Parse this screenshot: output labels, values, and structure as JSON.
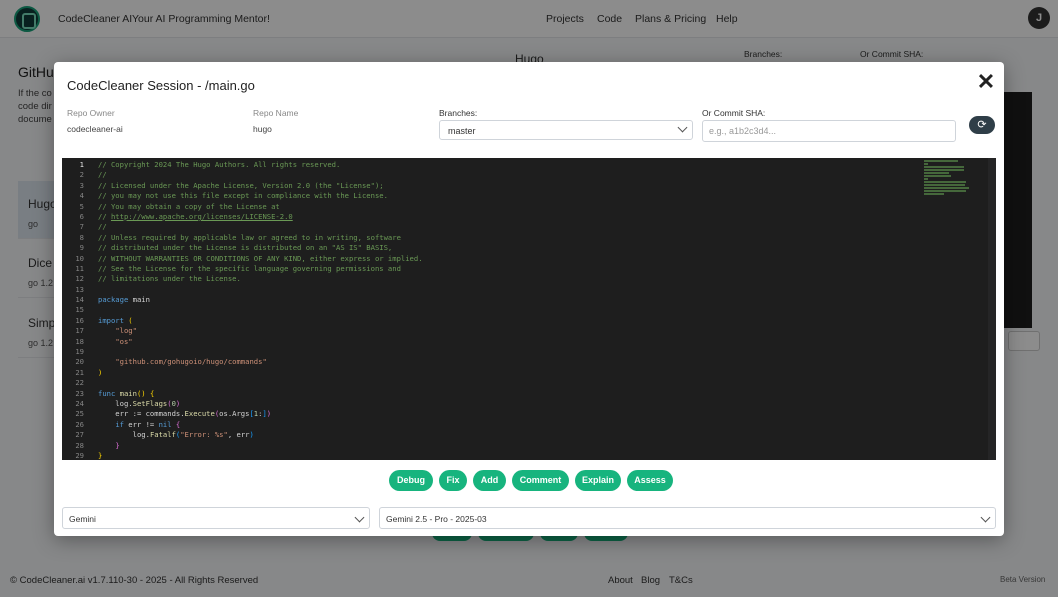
{
  "header": {
    "brand": "CodeCleaner AI",
    "tagline": "Your AI Programming Mentor!",
    "nav": [
      "Projects",
      "Code",
      "Plans & Pricing",
      "Help"
    ],
    "avatar_initial": "J"
  },
  "background": {
    "title_fragment": "GitHu",
    "text_fragments": [
      "If the co",
      "code dir",
      "docume"
    ],
    "repo_cards": [
      {
        "name": "Hugo",
        "sub": "go"
      },
      {
        "name": "Dice",
        "sub": "go 1.2"
      },
      {
        "name": "Simp",
        "sub": "go 1.2"
      }
    ],
    "center_title": "Hugo",
    "branches_label": "Branches:",
    "sha_label": "Or Commit SHA:"
  },
  "modal": {
    "title": "CodeCleaner Session - /main.go",
    "close_glyph": "✕",
    "repo_owner_label": "Repo Owner",
    "repo_owner": "codecleaner-ai",
    "repo_name_label": "Repo Name",
    "repo_name": "hugo",
    "branches_label": "Branches:",
    "branch_selected": "master",
    "sha_label": "Or Commit SHA:",
    "sha_placeholder": "e.g., a1b2c3d4...",
    "refresh_glyph": "⟳",
    "actions": [
      "Debug",
      "Fix",
      "Add",
      "Comment",
      "Explain",
      "Assess"
    ],
    "provider_selected": "Gemini",
    "model_selected": "Gemini 2.5 - Pro - 2025-03"
  },
  "code": {
    "current_line": 1,
    "lines": [
      [
        [
          "c-com",
          "// Copyright 2024 The Hugo Authors. All rights reserved."
        ]
      ],
      [
        [
          "c-com",
          "//"
        ]
      ],
      [
        [
          "c-com",
          "// Licensed under the Apache License, Version 2.0 (the \"License\");"
        ]
      ],
      [
        [
          "c-com",
          "// you may not use this file except in compliance with the License."
        ]
      ],
      [
        [
          "c-com",
          "// You may obtain a copy of the License at"
        ]
      ],
      [
        [
          "c-com",
          "// "
        ],
        [
          "c-com u",
          "http://www.apache.org/licenses/LICENSE-2.0"
        ]
      ],
      [
        [
          "c-com",
          "//"
        ]
      ],
      [
        [
          "c-com",
          "// Unless required by applicable law or agreed to in writing, software"
        ]
      ],
      [
        [
          "c-com",
          "// distributed under the License is distributed on an \"AS IS\" BASIS,"
        ]
      ],
      [
        [
          "c-com",
          "// WITHOUT WARRANTIES OR CONDITIONS OF ANY KIND, either express or implied."
        ]
      ],
      [
        [
          "c-com",
          "// See the License for the specific language governing permissions and"
        ]
      ],
      [
        [
          "c-com",
          "// limitations under the License."
        ]
      ],
      [],
      [
        [
          "c-kw",
          "package"
        ],
        [
          "",
          " main"
        ]
      ],
      [],
      [
        [
          "c-kw",
          "import"
        ],
        [
          "",
          " "
        ],
        [
          "c-br",
          "("
        ]
      ],
      [
        [
          "",
          "    "
        ],
        [
          "c-str",
          "\"log\""
        ]
      ],
      [
        [
          "",
          "    "
        ],
        [
          "c-str",
          "\"os\""
        ]
      ],
      [],
      [
        [
          "",
          "    "
        ],
        [
          "c-str",
          "\"github.com/gohugoio/hugo/commands\""
        ]
      ],
      [
        [
          "c-br",
          ")"
        ]
      ],
      [],
      [
        [
          "c-kw",
          "func"
        ],
        [
          "",
          " "
        ],
        [
          "c-fn",
          "main"
        ],
        [
          "c-br",
          "()"
        ],
        [
          "",
          " "
        ],
        [
          "c-br",
          "{"
        ]
      ],
      [
        [
          "",
          "    log."
        ],
        [
          "c-fn",
          "SetFlags"
        ],
        [
          "c-br2",
          "("
        ],
        [
          "c-num",
          "0"
        ],
        [
          "c-br2",
          ")"
        ]
      ],
      [
        [
          "",
          "    err := commands."
        ],
        [
          "c-fn",
          "Execute"
        ],
        [
          "c-br2",
          "("
        ],
        [
          "",
          "os.Args"
        ],
        [
          "c-br3",
          "["
        ],
        [
          "c-num",
          "1"
        ],
        [
          "",
          ":"
        ],
        [
          "c-br3",
          "]"
        ],
        [
          "c-br2",
          ")"
        ]
      ],
      [
        [
          "",
          "    "
        ],
        [
          "c-kw",
          "if"
        ],
        [
          "",
          " err != "
        ],
        [
          "c-kw",
          "nil"
        ],
        [
          "",
          " "
        ],
        [
          "c-br2",
          "{"
        ]
      ],
      [
        [
          "",
          "        log."
        ],
        [
          "c-fn",
          "Fatalf"
        ],
        [
          "c-br3",
          "("
        ],
        [
          "c-str",
          "\"Error: %s\""
        ],
        [
          "",
          ", err"
        ],
        [
          "c-br3",
          ")"
        ]
      ],
      [
        [
          "",
          "    "
        ],
        [
          "c-br2",
          "}"
        ]
      ],
      [
        [
          "c-br",
          "}"
        ]
      ]
    ]
  },
  "footer": {
    "copyright": "© CodeCleaner.ai v1.7.110-30 - 2025 - All Rights Reserved",
    "links": [
      "About",
      "Blog",
      "T&Cs"
    ],
    "beta": "Beta Version"
  },
  "colors": {
    "accent": "#17b47e",
    "editor_bg": "#1e1e1e",
    "comment": "#6a9955",
    "keyword": "#569cd6",
    "string": "#ce9178"
  }
}
